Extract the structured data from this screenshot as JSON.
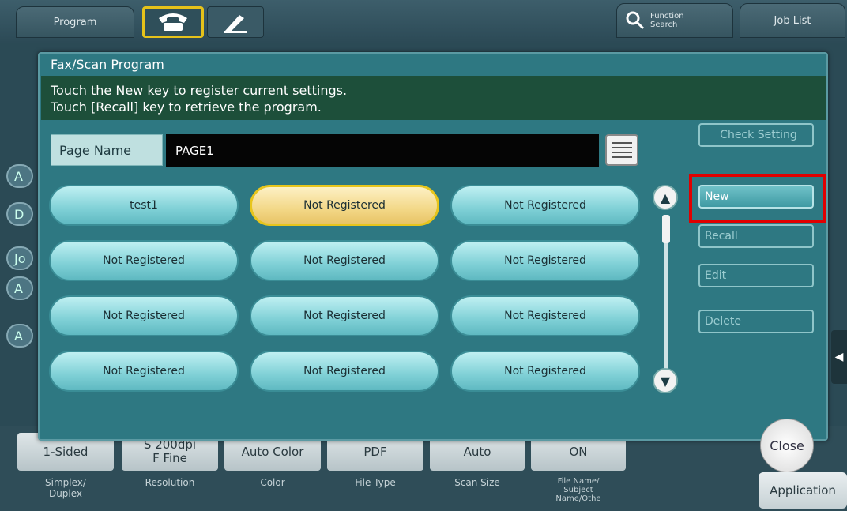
{
  "topbar": {
    "program_label": "Program",
    "function_search_label": "Function\nSearch",
    "job_list_label": "Job List"
  },
  "background_left": [
    "A",
    "D",
    "Jo",
    "A",
    "A"
  ],
  "bottom": {
    "buttons": [
      "1-Sided",
      "S 200dpi\nF Fine",
      "Auto Color",
      "PDF",
      "Auto",
      "ON"
    ],
    "labels": [
      "Simplex/\nDuplex",
      "Resolution",
      "Color",
      "File Type",
      "Scan Size",
      "File Name/\nSubject\nName/Othe"
    ]
  },
  "dialog": {
    "title": "Fax/Scan Program",
    "instructions": "Touch the New key to register current settings.\nTouch [Recall] key to retrieve the program.",
    "page_name_label": "Page Name",
    "page_name_value": "PAGE1",
    "programs": [
      "test1",
      "Not Registered",
      "Not Registered",
      "Not Registered",
      "Not Registered",
      "Not Registered",
      "Not Registered",
      "Not Registered",
      "Not Registered",
      "Not Registered",
      "Not Registered",
      "Not Registered"
    ],
    "selected_index": 1,
    "side": {
      "check_setting": "Check Setting",
      "new": "New",
      "recall": "Recall",
      "edit": "Edit",
      "delete": "Delete"
    },
    "close": "Close"
  },
  "application_label": "Application",
  "colors": {
    "highlight": "#e00000",
    "selected_border": "#e7c51c"
  }
}
